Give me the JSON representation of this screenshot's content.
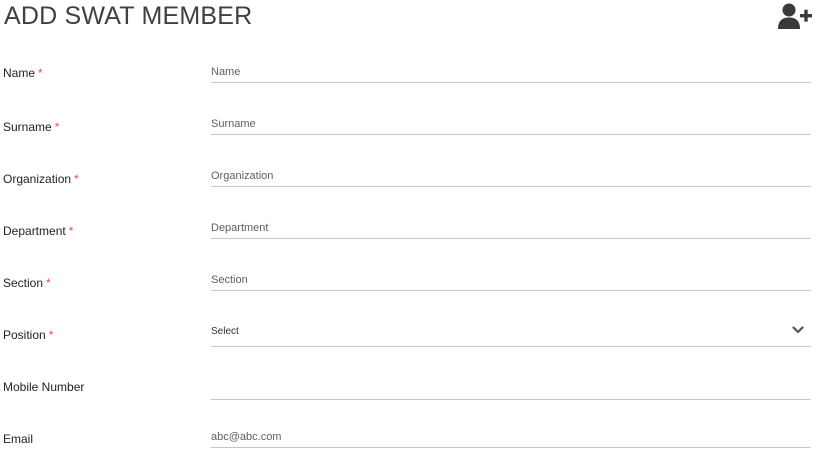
{
  "header": {
    "title": "ADD SWAT MEMBER",
    "icon": "add-user-icon"
  },
  "colors": {
    "required": "#d9534f",
    "underline": "#c8c8c8",
    "icon": "#3a3a3a"
  },
  "form": {
    "name": {
      "label": "Name",
      "required_mark": "*",
      "placeholder": "Name",
      "value": ""
    },
    "surname": {
      "label": "Surname",
      "required_mark": "*",
      "placeholder": "Surname",
      "value": ""
    },
    "organization": {
      "label": "Organization",
      "required_mark": "*",
      "placeholder": "Organization",
      "value": ""
    },
    "department": {
      "label": "Department",
      "required_mark": "*",
      "placeholder": "Department",
      "value": ""
    },
    "section": {
      "label": "Section",
      "required_mark": "*",
      "placeholder": "Section",
      "value": ""
    },
    "position": {
      "label": "Position",
      "required_mark": "*",
      "selected": "Select",
      "icon": "chevron-down-icon"
    },
    "mobile": {
      "label": "Mobile Number",
      "placeholder": "",
      "value": ""
    },
    "email": {
      "label": "Email",
      "placeholder": "abc@abc.com",
      "value": ""
    }
  }
}
